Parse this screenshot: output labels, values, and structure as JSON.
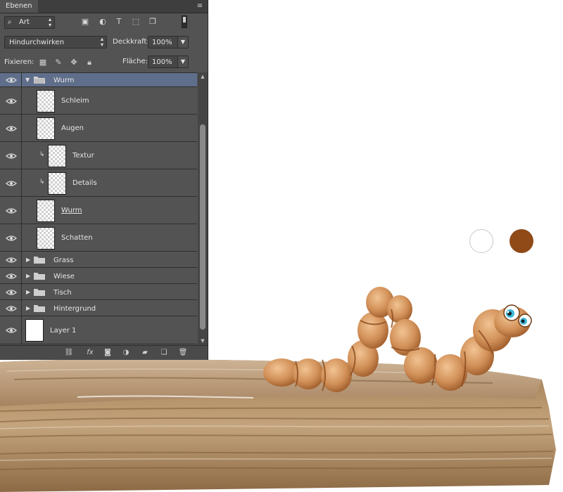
{
  "panel": {
    "tab_label": "Ebenen",
    "filter": {
      "value": "Art",
      "icons": [
        "image-filter-icon",
        "adjustment-filter-icon",
        "type-filter-icon",
        "shape-filter-icon",
        "smart-object-filter-icon"
      ]
    },
    "blend_mode": "Hindurchwirken",
    "opacity_label": "Deckkraft:",
    "opacity_value": "100%",
    "lock_label": "Fixieren:",
    "fill_label": "Fläche:",
    "fill_value": "100%",
    "layers": [
      {
        "name": "Wurm",
        "kind": "group-open",
        "selected": true
      },
      {
        "name": "Schleim",
        "kind": "layer",
        "indent": 1
      },
      {
        "name": "Augen",
        "kind": "layer",
        "indent": 1
      },
      {
        "name": "Textur",
        "kind": "clipped",
        "indent": 1
      },
      {
        "name": "Details",
        "kind": "clipped",
        "indent": 1
      },
      {
        "name": "Wurm",
        "kind": "layer",
        "indent": 1,
        "underline": true
      },
      {
        "name": "Schatten",
        "kind": "layer",
        "indent": 1
      },
      {
        "name": "Grass",
        "kind": "group"
      },
      {
        "name": "Wiese",
        "kind": "group"
      },
      {
        "name": "Tisch",
        "kind": "group"
      },
      {
        "name": "Hintergrund",
        "kind": "group"
      },
      {
        "name": "Layer 1",
        "kind": "white"
      }
    ],
    "toolbar_fx": "fx"
  },
  "swatches": {
    "white": "#ffffff",
    "brown": "#8f4a18"
  },
  "colors": {
    "panel_bg": "#535353",
    "selection": "#5f6e8a",
    "log": "#b08558",
    "worm": "#d18f57"
  }
}
